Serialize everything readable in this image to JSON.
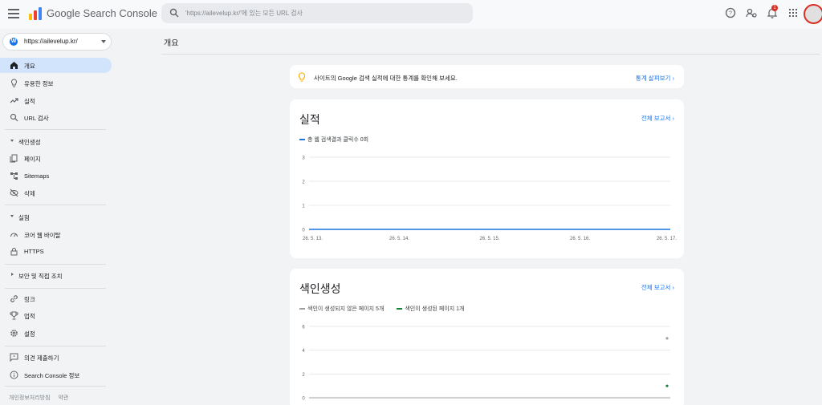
{
  "app": {
    "title": "Google Search Console"
  },
  "search": {
    "placeholder": "'https://ailevelup.kr/'에 있는 모든 URL 검사"
  },
  "header": {
    "notification_count": "1"
  },
  "property": {
    "label": "https://ailevelup.kr/"
  },
  "sidebar": {
    "items": [
      {
        "label": "개요",
        "icon": "home-icon",
        "active": true
      },
      {
        "label": "유용한 정보",
        "icon": "lightbulb-icon"
      },
      {
        "label": "실적",
        "icon": "trending-up-icon"
      },
      {
        "label": "URL 검사",
        "icon": "search-icon"
      }
    ],
    "sections": [
      {
        "label": "색인생성",
        "expanded": true,
        "items": [
          {
            "label": "페이지",
            "icon": "pages-icon"
          },
          {
            "label": "Sitemaps",
            "icon": "sitemap-icon"
          },
          {
            "label": "삭제",
            "icon": "visibility-off-icon"
          }
        ]
      },
      {
        "label": "실험",
        "expanded": true,
        "items": [
          {
            "label": "코어 웹 바이탈",
            "icon": "speed-icon"
          },
          {
            "label": "HTTPS",
            "icon": "lock-icon"
          }
        ]
      },
      {
        "label": "보안 및 직접 조치",
        "expanded": false,
        "items": []
      }
    ],
    "bottom_items": [
      {
        "label": "링크",
        "icon": "link-icon"
      },
      {
        "label": "업적",
        "icon": "trophy-icon"
      },
      {
        "label": "설정",
        "icon": "settings-icon"
      }
    ],
    "extra_items": [
      {
        "label": "의견 제출하기",
        "icon": "feedback-icon"
      },
      {
        "label": "Search Console 정보",
        "icon": "info-icon"
      }
    ],
    "footer": {
      "privacy": "개인정보처리방침",
      "terms": "약관"
    }
  },
  "main": {
    "page_title": "개요",
    "tip": {
      "text": "사이트의 Google 검색 실적에 대한 통계를 확인해 보세요.",
      "link": "통계 살펴보기"
    },
    "performance": {
      "title": "실적",
      "report_link": "전체 보고서"
    },
    "indexing": {
      "title": "색인생성",
      "report_link": "전체 보고서"
    }
  },
  "colors": {
    "accent": "#1a73e8",
    "active_bg": "#d2e3fc",
    "indexed": "#188038",
    "not_indexed": "#9aa0a6"
  },
  "chart_data": [
    {
      "type": "line",
      "title": "",
      "series": [
        {
          "name": "총 웹 검색결과 클릭수 0회",
          "color": "#1a73e8",
          "values": [
            0,
            0,
            0,
            0,
            0
          ]
        }
      ],
      "x": [
        "26. 5. 13.",
        "26. 5. 14.",
        "26. 5. 15.",
        "26. 5. 16.",
        "26. 5. 17."
      ],
      "yticks": [
        0,
        1,
        2,
        3
      ],
      "ylim": [
        0,
        3
      ],
      "grid": true
    },
    {
      "type": "scatter",
      "title": "",
      "series": [
        {
          "name": "색인이 생성되지 않은 페이지 5개",
          "color": "#9aa0a6",
          "points": [
            {
              "x": 1,
              "y": 5
            }
          ]
        },
        {
          "name": "색인이 생성된 페이지 1개",
          "color": "#188038",
          "points": [
            {
              "x": 1,
              "y": 1
            }
          ]
        }
      ],
      "xlim": [
        0,
        1
      ],
      "yticks": [
        0,
        2,
        4,
        6
      ],
      "ylim": [
        0,
        6
      ],
      "grid": true
    }
  ]
}
